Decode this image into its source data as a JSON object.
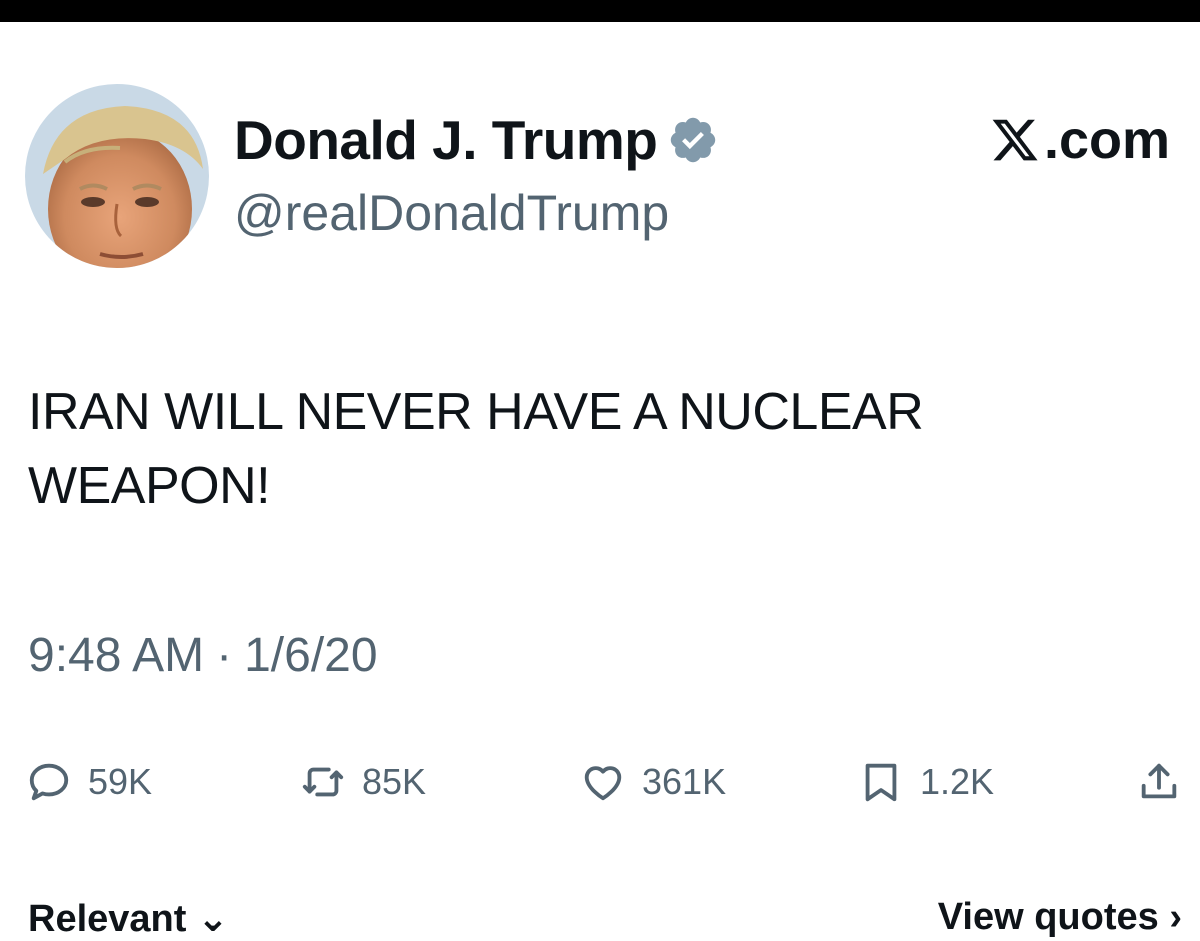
{
  "header": {
    "display_name": "Donald J. Trump",
    "handle": "@realDonaldTrump",
    "site": ".com",
    "verified_icon": "verified-badge-icon",
    "logo_icon": "x-logo-icon"
  },
  "tweet": {
    "text": "IRAN WILL NEVER HAVE A NUCLEAR WEAPON!",
    "time": "9:48 AM",
    "separator": "·",
    "date": "1/6/20"
  },
  "actions": {
    "replies": "59K",
    "reposts": "85K",
    "likes": "361K",
    "bookmarks": "1.2K"
  },
  "footer": {
    "sort_label": "Relevant",
    "quotes_label": "View quotes"
  },
  "colors": {
    "text": "#0f1419",
    "secondary": "#536471",
    "verified": "#829aab",
    "top_bar": "#000000"
  }
}
